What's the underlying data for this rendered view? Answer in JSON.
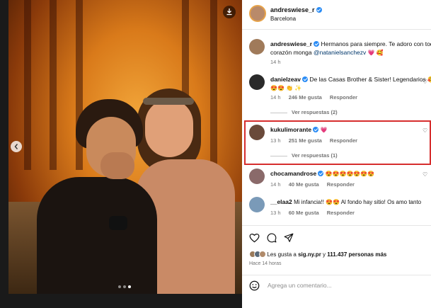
{
  "post": {
    "author": "andreswiese_r",
    "location": "Barcelona",
    "caption_author": "andreswiese_r",
    "caption_text": "Hermanos para siempre. Te adoro con todo",
    "caption_text2": "corazón monga",
    "caption_mention": "@natanielsanchezv",
    "caption_emojis": "💗 🥰",
    "caption_time": "14 h"
  },
  "comments": [
    {
      "user": "danielzeav",
      "verified": true,
      "text": "De las Casas Brother & Sister! Legendarios 🥰",
      "text2": "😍😍 👏 ✨",
      "time": "14 h",
      "likes": "246 Me gusta",
      "reply": "Responder",
      "view_replies": "Ver respuestas (2)"
    },
    {
      "user": "kukulimorante",
      "verified": true,
      "text": "💗",
      "time": "13 h",
      "likes": "251 Me gusta",
      "reply": "Responder",
      "view_replies": "Ver respuestas (1)"
    },
    {
      "user": "chocamandrose",
      "verified": true,
      "text": "😍😍😍😍😍😍😍",
      "time": "14 h",
      "likes": "40 Me gusta",
      "reply": "Responder"
    },
    {
      "user": "__elaa2",
      "verified": false,
      "text": "Mi infancia!! 😍😍 Al fondo hay sitio! Os amo tanto",
      "time": "13 h",
      "likes": "60 Me gusta",
      "reply": "Responder"
    }
  ],
  "likes_summary": {
    "prefix": "Les gusta a",
    "user": "sig.ny.pr",
    "middle": "y",
    "count": "111.437 personas más",
    "when": "Hace 14 horas"
  },
  "add_comment": {
    "placeholder": "Agrega un comentario..."
  },
  "colors": {
    "highlight": "#d62d2d",
    "verified": "#2a8cf5",
    "link": "#00376b"
  },
  "icons": [
    "download-icon",
    "chevron-left-icon",
    "heart-icon",
    "comment-icon",
    "share-icon",
    "smile-icon",
    "verified-badge-icon"
  ]
}
